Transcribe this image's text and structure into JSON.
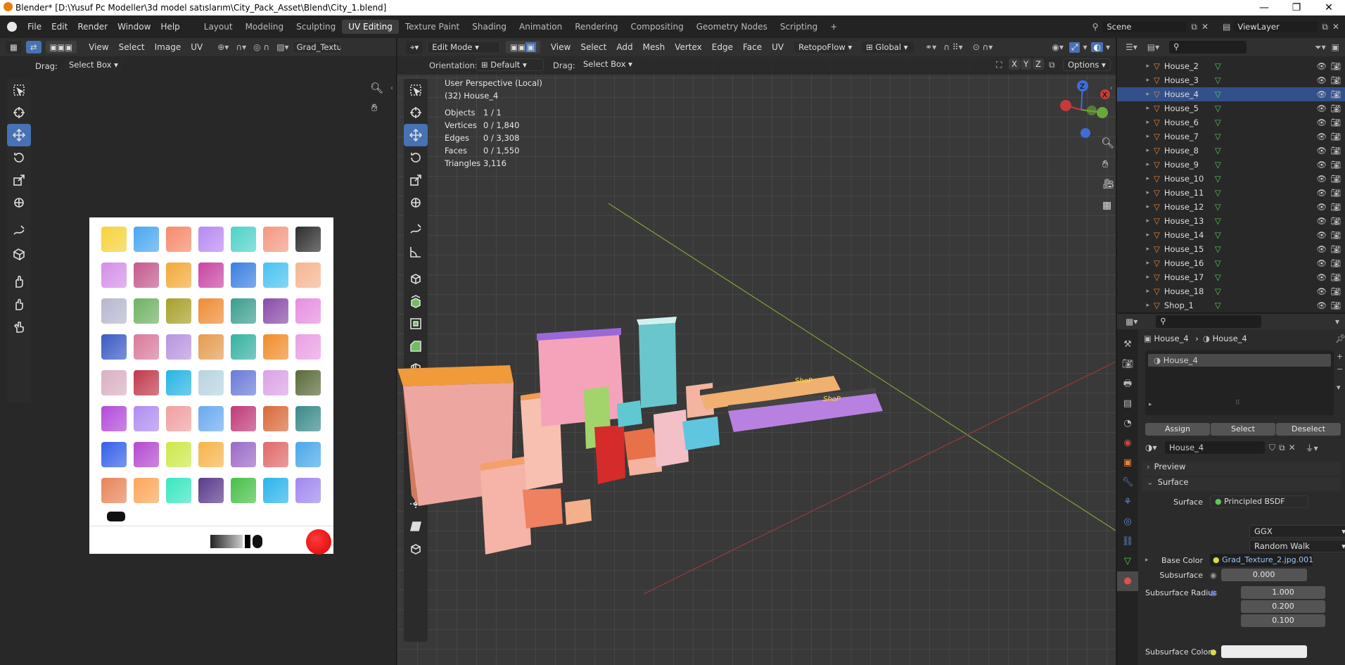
{
  "window": {
    "title": "Blender* [D:\\Yusuf Pc Modeller\\3d model satıslarım\\City_Pack_Asset\\Blend\\City_1.blend]",
    "minimize": "—",
    "maximize": "❐",
    "close": "✕"
  },
  "menu": {
    "file": "File",
    "edit": "Edit",
    "render": "Render",
    "window": "Window",
    "help": "Help"
  },
  "workspaces": [
    "Layout",
    "Modeling",
    "Sculpting",
    "UV Editing",
    "Texture Paint",
    "Shading",
    "Animation",
    "Rendering",
    "Compositing",
    "Geometry Nodes",
    "Scripting"
  ],
  "scene": {
    "label": "Scene",
    "view_layer": "ViewLayer"
  },
  "uv_editor": {
    "header": {
      "view": "View",
      "select": "Select",
      "image": "Image",
      "uv": "UV",
      "image_name": "Grad_Textur"
    },
    "drag_label": "Drag:",
    "drag_value": "Select Box"
  },
  "viewport": {
    "header": {
      "mode": "Edit Mode",
      "view": "View",
      "select": "Select",
      "add": "Add",
      "mesh": "Mesh",
      "vertex": "Vertex",
      "edge": "Edge",
      "face": "Face",
      "uv": "UV",
      "retopoflow": "RetopoFlow",
      "transform": "Global"
    },
    "orientation_label": "Orientation:",
    "orientation_value": "Default",
    "drag_label": "Drag:",
    "drag_value": "Select Box",
    "options": "Options",
    "axes": [
      "X",
      "Y",
      "Z"
    ],
    "overlay": {
      "perspective": "User Perspective (Local)",
      "object": "(32) House_4",
      "stats": [
        {
          "k": "Objects",
          "v": "1 / 1"
        },
        {
          "k": "Vertices",
          "v": "0 / 1,840"
        },
        {
          "k": "Edges",
          "v": "0 / 3,308"
        },
        {
          "k": "Faces",
          "v": "0 / 1,550"
        },
        {
          "k": "Triangles",
          "v": "3,116"
        }
      ]
    },
    "gizmo": {
      "z": "Z",
      "x": "X",
      "y": "Y"
    },
    "signs": [
      "ShoP",
      "ShoP"
    ]
  },
  "outliner": {
    "items": [
      "House_2",
      "House_3",
      "House_4",
      "House_5",
      "House_6",
      "House_7",
      "House_8",
      "House_9",
      "House_10",
      "House_11",
      "House_12",
      "House_13",
      "House_14",
      "House_15",
      "House_16",
      "House_17",
      "House_18",
      "Shop_1"
    ],
    "selected": "House_4"
  },
  "properties": {
    "breadcrumb_a": "House_4",
    "breadcrumb_b": "House_4",
    "slot": "House_4",
    "assign": "Assign",
    "select": "Select",
    "deselect": "Deselect",
    "material_name": "House_4",
    "preview": "Preview",
    "surface_panel": "Surface",
    "surface_label": "Surface",
    "surface_value": "Principled BSDF",
    "distribution": "GGX",
    "subsurface_method": "Random Walk",
    "base_color_label": "Base Color",
    "base_color_value": "Grad_Texture_2.jpg.001",
    "subsurface_label": "Subsurface",
    "subsurface_value": "0.000",
    "subsurface_radius_label": "Subsurface Radius",
    "radius": [
      "1.000",
      "0.200",
      "0.100"
    ],
    "subsurface_color_label": "Subsurface Color"
  },
  "texture_swatches": [
    [
      "#f6d23a",
      "#4aa7f0",
      "#f58a6b",
      "#b889f2",
      "#4fd2c8",
      "#f49883",
      "#2d2d2d"
    ],
    [
      "#d48fe8",
      "#c45a8e",
      "#f3a93a",
      "#c845a4",
      "#3b7fe0",
      "#48c2f0",
      "#f4b690"
    ],
    [
      "#b7b7cf",
      "#6fb263",
      "#a8a02a",
      "#ef8b34",
      "#3a9e8e",
      "#8a4ba8",
      "#e68ee0"
    ],
    [
      "#3a5ac4",
      "#d97a9a",
      "#b895df",
      "#e49c50",
      "#35b2a0",
      "#f08d2a",
      "#e9a0e4"
    ],
    [
      "#d9b0c2",
      "#c03a4a",
      "#27b4e4",
      "#b8d4e0",
      "#6a7ad8",
      "#dba2e6",
      "#5a6a3a"
    ],
    [
      "#b24ad8",
      "#b08cf0",
      "#f0a0a0",
      "#6aaaf0",
      "#c03a7a",
      "#d86a3a",
      "#3a8a8a"
    ],
    [
      "#3460e8",
      "#b44ad0",
      "#cde84a",
      "#f6b44a",
      "#9a6ac8",
      "#e06a6a",
      "#4aa7ea"
    ],
    [
      "#e8845a",
      "#fba65a",
      "#3ae6c0",
      "#5a3a8a",
      "#48c048",
      "#2ab4ea",
      "#a088ee"
    ]
  ]
}
